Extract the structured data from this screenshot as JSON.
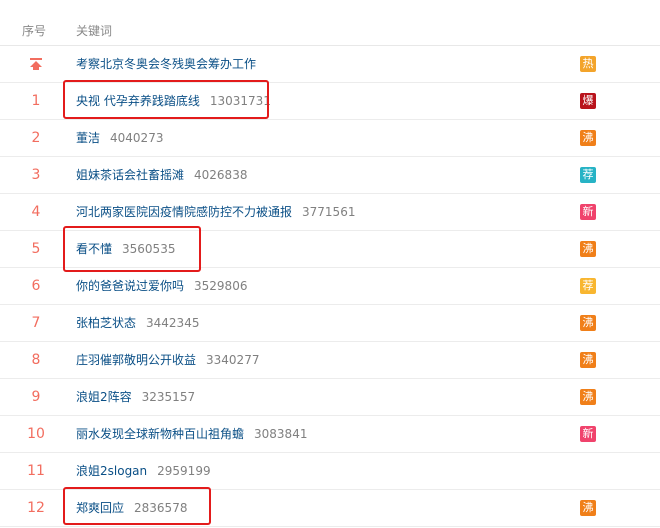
{
  "header": {
    "rank_label": "序号",
    "keyword_label": "关键词"
  },
  "rows": [
    {
      "rank": "",
      "title": "考察北京冬奥会冬残奥会筹办工作",
      "count": "",
      "badge": "热",
      "badge_color": "#f3a42b",
      "pinned": true
    },
    {
      "rank": "1",
      "title": "央视 代孕弃养践踏底线",
      "count": "13031731",
      "badge": "爆",
      "badge_color": "#b9131c"
    },
    {
      "rank": "2",
      "title": "董洁",
      "count": "4040273",
      "badge": "沸",
      "badge_color": "#f07f19"
    },
    {
      "rank": "3",
      "title": "姐妹茶话会社畜摇滩",
      "count": "4026838",
      "badge": "荐",
      "badge_color": "#27b3c5"
    },
    {
      "rank": "4",
      "title": "河北两家医院因疫情院感防控不力被通报",
      "count": "3771561",
      "badge": "新",
      "badge_color": "#f0436c"
    },
    {
      "rank": "5",
      "title": "看不懂",
      "count": "3560535",
      "badge": "沸",
      "badge_color": "#f07f19"
    },
    {
      "rank": "6",
      "title": "你的爸爸说过爱你吗",
      "count": "3529806",
      "badge": "荐",
      "badge_color": "#f8b630"
    },
    {
      "rank": "7",
      "title": "张柏芝状态",
      "count": "3442345",
      "badge": "沸",
      "badge_color": "#f07f19"
    },
    {
      "rank": "8",
      "title": "庄羽催郭敬明公开收益",
      "count": "3340277",
      "badge": "沸",
      "badge_color": "#f07f19"
    },
    {
      "rank": "9",
      "title": "浪姐2阵容",
      "count": "3235157",
      "badge": "沸",
      "badge_color": "#f07f19"
    },
    {
      "rank": "10",
      "title": "丽水发现全球新物种百山祖角蟾",
      "count": "3083841",
      "badge": "新",
      "badge_color": "#f0436c"
    },
    {
      "rank": "11",
      "title": "浪姐2slogan",
      "count": "2959199",
      "badge": "",
      "badge_color": ""
    },
    {
      "rank": "12",
      "title": "郑爽回应",
      "count": "2836578",
      "badge": "沸",
      "badge_color": "#f07f19"
    }
  ],
  "colors": {
    "highlight": "#e31b1b",
    "rank": "#f26d5f",
    "link": "#0a4f86"
  },
  "icons": {
    "pinned": "pin-top-icon"
  }
}
